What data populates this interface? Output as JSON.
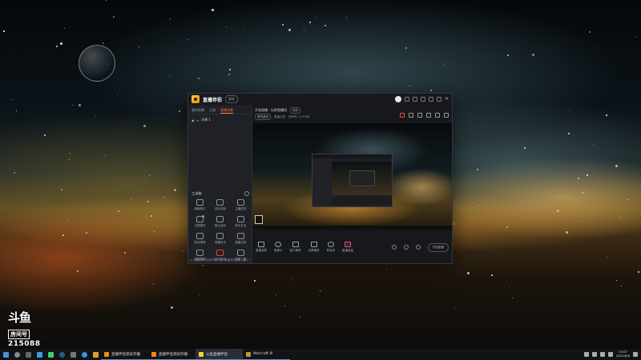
{
  "app": {
    "name": "直播伴侣",
    "version": "测试",
    "left_tabs": [
      "我的直播",
      "工具",
      "直播场景"
    ],
    "scene_label": "场景 1",
    "tools_title": "工具箱",
    "tools": [
      {
        "label": "弹幕助手",
        "icon": "danmaku-icon"
      },
      {
        "label": "送礼特效",
        "icon": "gift-icon"
      },
      {
        "label": "主播任务",
        "icon": "task-icon"
      },
      {
        "label": "点歌插件",
        "icon": "music-icon"
      },
      {
        "label": "鱼丸活动",
        "icon": "fishball-icon"
      },
      {
        "label": "新手礼包",
        "icon": "package-icon"
      },
      {
        "label": "粉丝榜单",
        "icon": "fans-icon"
      },
      {
        "label": "竞猜玩法",
        "icon": "quiz-icon"
      },
      {
        "label": "直播日历",
        "icon": "calendar-icon"
      },
      {
        "label": "直播数据",
        "icon": "data-icon"
      },
      {
        "label": "热门活动",
        "icon": "hot-icon"
      },
      {
        "label": "更多工具",
        "icon": "more-icon"
      }
    ],
    "notice": "◎ 斗鱼公告 | 如何开启开播 | 直播伴侣攻略 | 看上一直播",
    "room_title": "开始直播 - 玩转直播间",
    "edit_label": "修改",
    "category_label": "直播分类",
    "category_value": "单机游戏",
    "room_stats": "房间号: 215088",
    "controls": [
      {
        "label": "直播录屏",
        "icon": "screen-record-icon"
      },
      {
        "label": "摄像头",
        "icon": "camera-icon"
      },
      {
        "label": "窗口捕获",
        "icon": "window-capture-icon"
      },
      {
        "label": "全屏捕获",
        "icon": "fullscreen-capture-icon"
      },
      {
        "label": "麦克风",
        "icon": "mic-icon"
      },
      {
        "label": "直播音量",
        "icon": "volume-icon"
      }
    ],
    "start_live_label": "开始直播"
  },
  "watermark": {
    "logo": "斗鱼",
    "sub": "房间号",
    "room_number": "215088"
  },
  "taskbar": {
    "items": [
      {
        "label": "直播伴侣测试开播",
        "color": "#ff8a00",
        "active": false
      },
      {
        "label": "直播伴侣测试开播",
        "color": "#ff8a00",
        "active": false
      },
      {
        "label": "斗鱼直播伴侣",
        "color": "#ffce3a",
        "active": true
      },
      {
        "label": "Warcraft III",
        "color": "#c49a2a",
        "active": false
      }
    ],
    "clock_time": "15:07",
    "clock_date": "2022/6/8"
  }
}
